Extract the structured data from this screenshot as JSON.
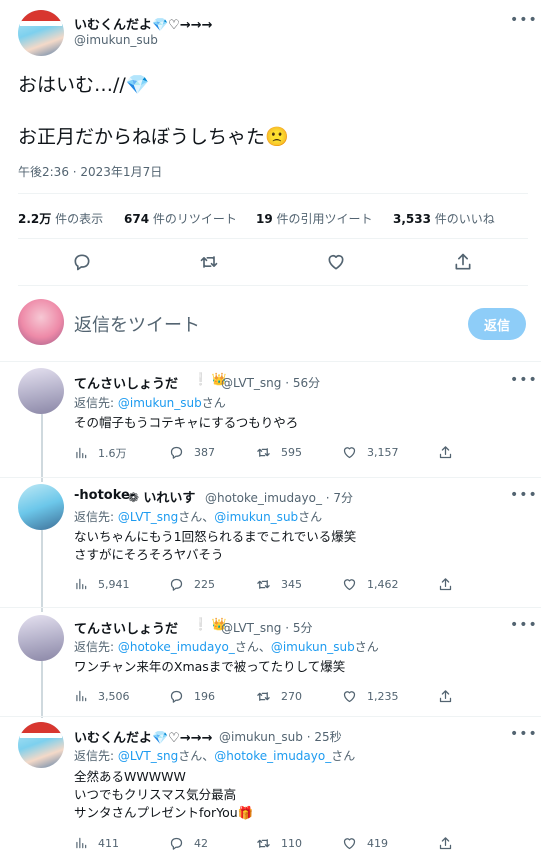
{
  "main_tweet": {
    "author_name": "いむくんだよ💎♡→→→",
    "author_handle": "@imukun_sub",
    "line1": "おはいむ…//💎",
    "line2": "お正月だからねぼうしちゃた🙁",
    "timestamp": "午後2:36 · 2023年1月7日",
    "stats": {
      "views_value": "2.2万",
      "views_label": "件の表示",
      "retweets_value": "674",
      "retweets_label": "件のリツイート",
      "quotes_value": "19",
      "quotes_label": "件の引用ツイート",
      "likes_value": "3,533",
      "likes_label": "件のいいね"
    }
  },
  "composer": {
    "placeholder": "返信をツイート",
    "button_label": "返信"
  },
  "replies": [
    {
      "name": "てんさいしょうだ",
      "badges": "❕ 👑",
      "handle_time": "@LVT_sng · 56分",
      "reply_to_prefix": "返信先: ",
      "mentions": [
        "@imukun_sub"
      ],
      "reply_to_suffix": "さん",
      "text": "その帽子もうコテキャにするつもりやろ",
      "views": "1.6万",
      "replies": "387",
      "retweets": "595",
      "likes": "3,157"
    },
    {
      "name": "-hotoke-",
      "badges": "❁ いれいす",
      "handle_time": "@hotoke_imudayo_ · 7分",
      "reply_to_prefix": "返信先: ",
      "mentions": [
        "@LVT_sng",
        "@imukun_sub"
      ],
      "mention_sep": "さん、",
      "reply_to_suffix": "さん",
      "text_lines": [
        "ないちゃんにもう1回怒られるまでこれでいる爆笑",
        "さすがにそろそろヤバそう"
      ],
      "views": "5,941",
      "replies": "225",
      "retweets": "345",
      "likes": "1,462"
    },
    {
      "name": "てんさいしょうだ",
      "badges": "❕ 👑",
      "handle_time": "@LVT_sng · 5分",
      "reply_to_prefix": "返信先: ",
      "mentions": [
        "@hotoke_imudayo_",
        "@imukun_sub"
      ],
      "mention_sep": "さん、",
      "reply_to_suffix": "さん",
      "text": "ワンチャン来年のXmasまで被ってたりして爆笑",
      "views": "3,506",
      "replies": "196",
      "retweets": "270",
      "likes": "1,235"
    },
    {
      "name": "いむくんだよ💎♡→→→",
      "handle_time": "@imukun_sub · 25秒",
      "reply_to_prefix": "返信先: ",
      "mentions": [
        "@LVT_sng",
        "@hotoke_imudayo_"
      ],
      "mention_sep": "さん、",
      "reply_to_suffix": "さん",
      "text_lines": [
        "全然あるWWWWW",
        "いつでもクリスマス気分最高",
        "サンタさんプレゼントforYou🎁"
      ],
      "views": "411",
      "replies": "42",
      "retweets": "110",
      "likes": "419"
    }
  ],
  "colors": {
    "accent": "#1d9bf0",
    "muted": "#536471",
    "divider": "#eff3f4",
    "button_disabled": "#8ecdf8"
  },
  "icons": [
    "more-icon",
    "reply-icon",
    "retweet-icon",
    "like-icon",
    "share-icon",
    "views-icon"
  ]
}
